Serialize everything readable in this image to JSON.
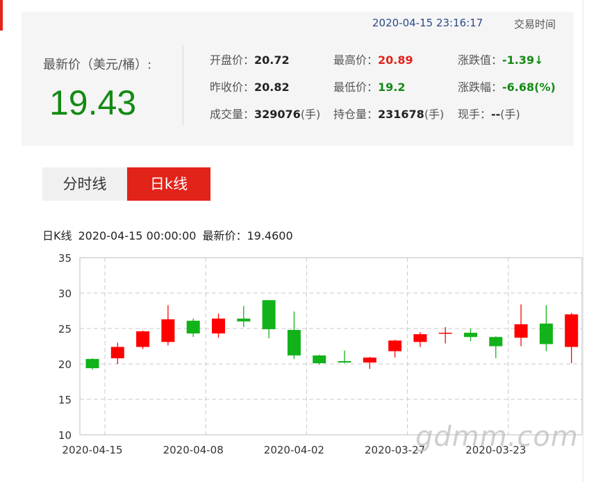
{
  "quote": {
    "timestamp": "2020-04-15 23:16:17",
    "timestamp_label": "交易时间",
    "price_label": "最新价（美元/桶）:",
    "price": "19.43",
    "open_label": "开盘价：",
    "open": "20.72",
    "high_label": "最高价：",
    "high": "20.89",
    "change_label": "涨跌值：",
    "change": "-1.39↓",
    "prev_close_label": "昨收价：",
    "prev_close": "20.82",
    "low_label": "最低价：",
    "low": "19.2",
    "change_pct_label": "涨跌幅：",
    "change_pct": "-6.68(%)",
    "volume_label": "成交量：",
    "volume": "329076",
    "volume_unit": "(手)",
    "open_interest_label": "持仓量：",
    "open_interest": "231678",
    "open_interest_unit": "(手)",
    "current_hand_label": "现手：",
    "current_hand": "--",
    "current_hand_unit": "(手)"
  },
  "tabs": [
    {
      "label": "分时线",
      "active": false
    },
    {
      "label": "日k线",
      "active": true
    }
  ],
  "chart_info": {
    "name": "日K线",
    "datetime": "2020-04-15 00:00:00",
    "latest_label": "最新价：",
    "latest_value": "19.4600"
  },
  "watermark": "gdmm.com",
  "colors": {
    "up": "#ff0000",
    "down": "#12b21a",
    "accent": "#e2231a",
    "price_green": "#138a13"
  },
  "chart_data": {
    "type": "candlestick",
    "ylim": [
      10,
      35
    ],
    "yticks": [
      10,
      15,
      20,
      25,
      30,
      35
    ],
    "x_tick_labels": [
      "2020-04-15",
      "2020-04-08",
      "2020-04-02",
      "2020-03-27",
      "2020-03-23"
    ],
    "x_tick_indices": [
      0,
      4,
      8,
      12,
      16
    ],
    "grid": true,
    "candles": [
      {
        "open": 20.7,
        "close": 19.4,
        "high": 20.8,
        "low": 19.2
      },
      {
        "open": 20.8,
        "close": 22.4,
        "high": 23.0,
        "low": 20.0
      },
      {
        "open": 22.4,
        "close": 24.6,
        "high": 24.7,
        "low": 22.1
      },
      {
        "open": 23.1,
        "close": 26.3,
        "high": 28.3,
        "low": 22.6
      },
      {
        "open": 26.1,
        "close": 24.3,
        "high": 26.4,
        "low": 23.8
      },
      {
        "open": 24.3,
        "close": 26.4,
        "high": 27.1,
        "low": 23.7
      },
      {
        "open": 26.4,
        "close": 26.0,
        "high": 28.2,
        "low": 25.2
      },
      {
        "open": 29.0,
        "close": 24.9,
        "high": 29.0,
        "low": 23.6
      },
      {
        "open": 24.8,
        "close": 21.2,
        "high": 27.4,
        "low": 20.7
      },
      {
        "open": 21.2,
        "close": 20.1,
        "high": 21.3,
        "low": 19.9
      },
      {
        "open": 20.4,
        "close": 20.2,
        "high": 21.9,
        "low": 20.1
      },
      {
        "open": 20.2,
        "close": 20.9,
        "high": 21.0,
        "low": 19.3
      },
      {
        "open": 21.8,
        "close": 23.3,
        "high": 23.4,
        "low": 20.9
      },
      {
        "open": 23.1,
        "close": 24.2,
        "high": 24.5,
        "low": 22.4
      },
      {
        "open": 24.3,
        "close": 24.4,
        "high": 25.2,
        "low": 22.9
      },
      {
        "open": 24.4,
        "close": 23.8,
        "high": 25.0,
        "low": 23.2
      },
      {
        "open": 23.8,
        "close": 22.5,
        "high": 23.9,
        "low": 20.8
      },
      {
        "open": 23.7,
        "close": 25.6,
        "high": 28.4,
        "low": 22.5
      },
      {
        "open": 25.7,
        "close": 22.8,
        "high": 28.3,
        "low": 21.8
      },
      {
        "open": 22.4,
        "close": 27.0,
        "high": 27.2,
        "low": 20.1
      }
    ]
  }
}
